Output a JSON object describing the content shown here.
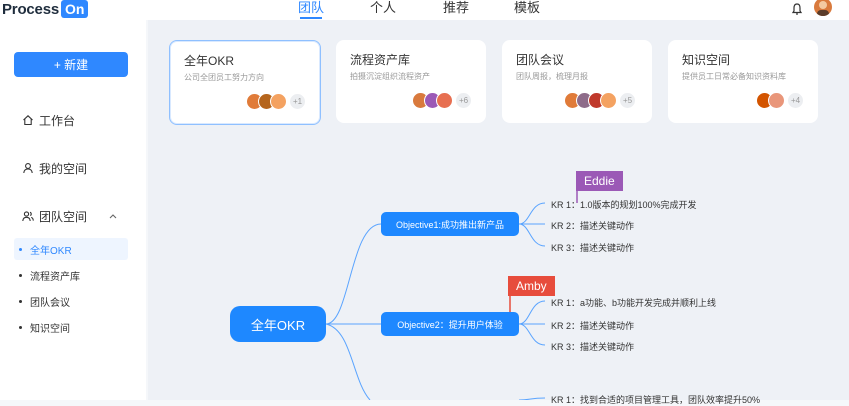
{
  "header": {
    "logo_text": "Process",
    "logo_badge": "On",
    "nav": [
      "团队",
      "个人",
      "推荐",
      "模板"
    ],
    "active_nav": "团队"
  },
  "sidebar": {
    "new_button": "+ 新建",
    "items": [
      {
        "label": "工作台",
        "icon": "home-icon"
      },
      {
        "label": "我的空间",
        "icon": "user-icon"
      },
      {
        "label": "团队空间",
        "icon": "team-icon",
        "expanded": true
      }
    ],
    "sub_items": [
      {
        "label": "全年OKR",
        "active": true
      },
      {
        "label": "流程资产库",
        "active": false
      },
      {
        "label": "团队会议",
        "active": false
      },
      {
        "label": "知识空间",
        "active": false
      }
    ]
  },
  "cards": [
    {
      "title": "全年OKR",
      "desc": "公司全团员工努力方向",
      "more": "+1",
      "active": true,
      "avatar_colors": [
        "#e07b39",
        "#b5651d",
        "#f4a261"
      ]
    },
    {
      "title": "流程资产库",
      "desc": "拍摄沉淀组织流程资产",
      "more": "+6",
      "active": false,
      "avatar_colors": [
        "#d97a3d",
        "#9b59b6",
        "#e76f51"
      ]
    },
    {
      "title": "团队会议",
      "desc": "团队周报，梳理月报",
      "more": "+5",
      "active": false,
      "avatar_colors": [
        "#e07b39",
        "#8e6c8a",
        "#c0392b",
        "#f4a261"
      ]
    },
    {
      "title": "知识空间",
      "desc": "提供员工日常必备知识资料库",
      "more": "+4",
      "active": false,
      "avatar_colors": [
        "#d35400",
        "#e9967a"
      ]
    }
  ],
  "mindmap": {
    "root": "全年OKR",
    "objectives": [
      {
        "label": "Objective1:成功推出新产品",
        "krs": [
          "KR 1：1.0版本的规划100%完成开发",
          "KR 2：描述关键动作",
          "KR 3：描述关键动作"
        ]
      },
      {
        "label": "Objective2：提升用户体验",
        "krs": [
          "KR 1：a功能、b功能开发完成并顺利上线",
          "KR 2：描述关键动作",
          "KR 3：描述关键动作"
        ]
      },
      {
        "label": "",
        "krs": [
          "KR 1：找到合适的项目管理工具，团队效率提升50%"
        ]
      }
    ],
    "tags": [
      {
        "label": "Eddie",
        "color": "#9b59b6"
      },
      {
        "label": "Amby",
        "color": "#e74c3c"
      }
    ]
  },
  "colors": {
    "accent": "#2f88ff",
    "node": "#1e88ff"
  }
}
